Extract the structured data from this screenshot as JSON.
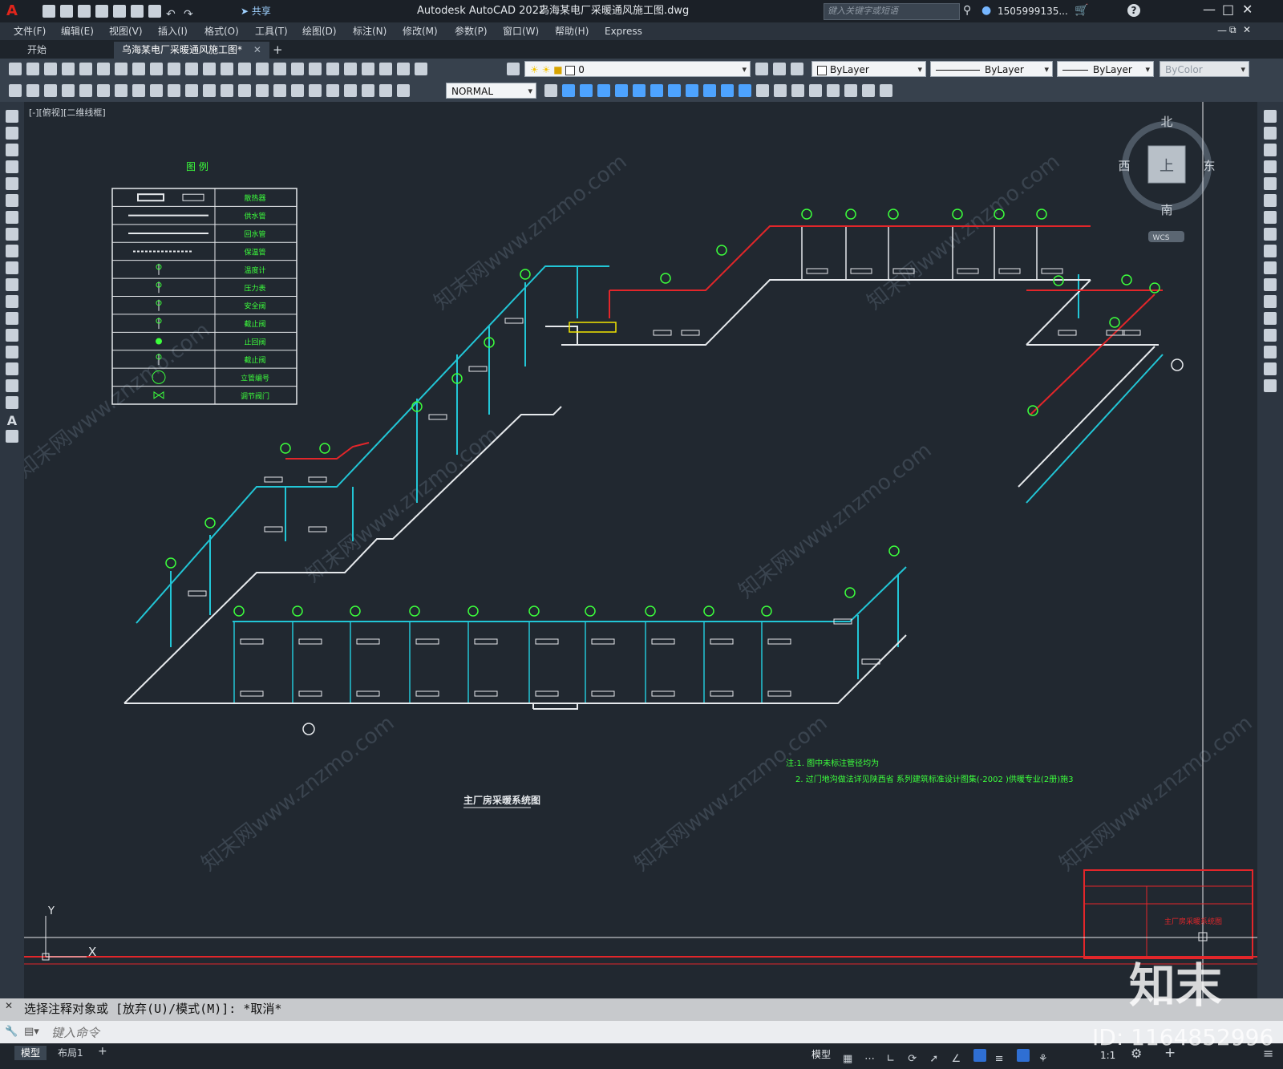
{
  "app": {
    "logo": "A",
    "title": "Autodesk AutoCAD 2022",
    "file": "乌海某电厂采暖通风施工图.dwg",
    "share": "共享",
    "search_placeholder": "键入关键字或短语",
    "user": "1505999135...",
    "window_controls": [
      "minimize-icon",
      "restore-icon",
      "close-icon"
    ]
  },
  "menu": [
    "文件(F)",
    "编辑(E)",
    "视图(V)",
    "插入(I)",
    "格式(O)",
    "工具(T)",
    "绘图(D)",
    "标注(N)",
    "修改(M)",
    "参数(P)",
    "窗口(W)",
    "帮助(H)",
    "Express"
  ],
  "tabs": [
    {
      "label": "开始",
      "active": false
    },
    {
      "label": "乌海某电厂采暖通风施工图*",
      "active": true
    }
  ],
  "toolbar": {
    "layer_value": "0",
    "color": "ByLayer",
    "linetype": "ByLayer",
    "lineweight": "ByLayer",
    "plotstyle": "ByColor",
    "textstyle": "NORMAL"
  },
  "viewport": {
    "label": "[-][俯视][二维线框]",
    "viewcube": {
      "north": "北",
      "south": "南",
      "east": "东",
      "west": "西",
      "face": "上",
      "wcs": "WCS"
    },
    "ucs": {
      "x": "X",
      "y": "Y"
    }
  },
  "drawing": {
    "legend_title": "图    例",
    "legend_items": [
      "散热器",
      "供水管",
      "回水管",
      "保温管",
      "温度计",
      "压力表",
      "安全阀",
      "截止阀",
      "止回阀",
      "截止阀",
      "立管编号",
      "调节阀门"
    ],
    "system_title": "主厂房采暖系统图",
    "notes": [
      "注:1. 图中未标注管径均为",
      "2. 过门地沟做法详见陕西省 系列建筑标准设计图集(-2002   )供暖专业(2册)施3"
    ],
    "title_block": "主厂房采暖系统图",
    "watermark": "知末网www.znzmo.com"
  },
  "command": {
    "history": "选择注释对象或 [放弃(U)/模式(M)]: *取消*",
    "placeholder": "键入命令"
  },
  "status": {
    "layouts": [
      "模型",
      "布局1"
    ],
    "model_label": "模型",
    "scale": "1:1",
    "brand": "知末",
    "id": "ID: 1164852996"
  }
}
